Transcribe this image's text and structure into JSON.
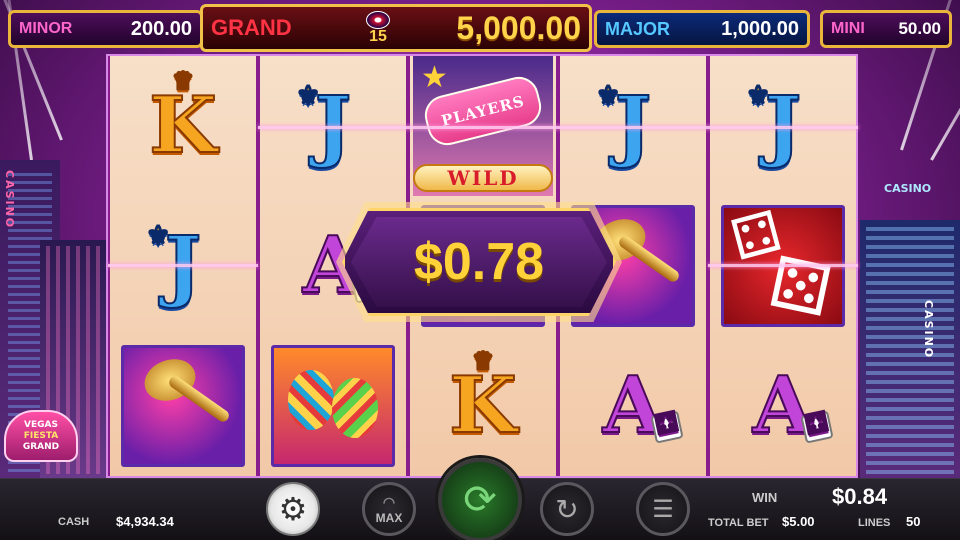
{
  "jackpots": {
    "minor": {
      "label": "MINOR",
      "value": "200.00"
    },
    "grand": {
      "label": "GRAND",
      "badge": "15",
      "value": "5,000.00"
    },
    "major": {
      "label": "MAJOR",
      "value": "1,000.00"
    },
    "mini": {
      "label": "MINI",
      "value": "50.00"
    }
  },
  "scenery": {
    "casino_left": "CASINO",
    "casino_right_top": "CASINO",
    "casino_right": "CASINO",
    "logo": [
      "VEGAS",
      "FIESTA",
      "GRAND"
    ]
  },
  "reels": [
    [
      "K",
      "J",
      "trumpet"
    ],
    [
      "J",
      "A",
      "maracas"
    ],
    [
      "wild",
      "trumpet",
      "K"
    ],
    [
      "J",
      "trumpet",
      "A"
    ],
    [
      "J",
      "dice",
      "A"
    ]
  ],
  "wild": {
    "sign": "PLAYERS",
    "word": "WILD"
  },
  "win_banner": {
    "amount": "$0.78"
  },
  "footer": {
    "cash_label": "CASH",
    "cash_value": "$4,934.34",
    "win_label": "WIN",
    "win_value": "$0.84",
    "total_bet_label": "TOTAL BET",
    "total_bet_value": "$5.00",
    "lines_label": "LINES",
    "lines_value": "50",
    "max_label": "MAX"
  },
  "icons": {
    "settings": "gear-icon",
    "spin": "spin-arrow-icon",
    "autoplay": "refresh-icon",
    "bet": "coin-stack-icon"
  },
  "colors": {
    "gold": "#ffd23a",
    "purple_bg": "#7a1f8c"
  }
}
